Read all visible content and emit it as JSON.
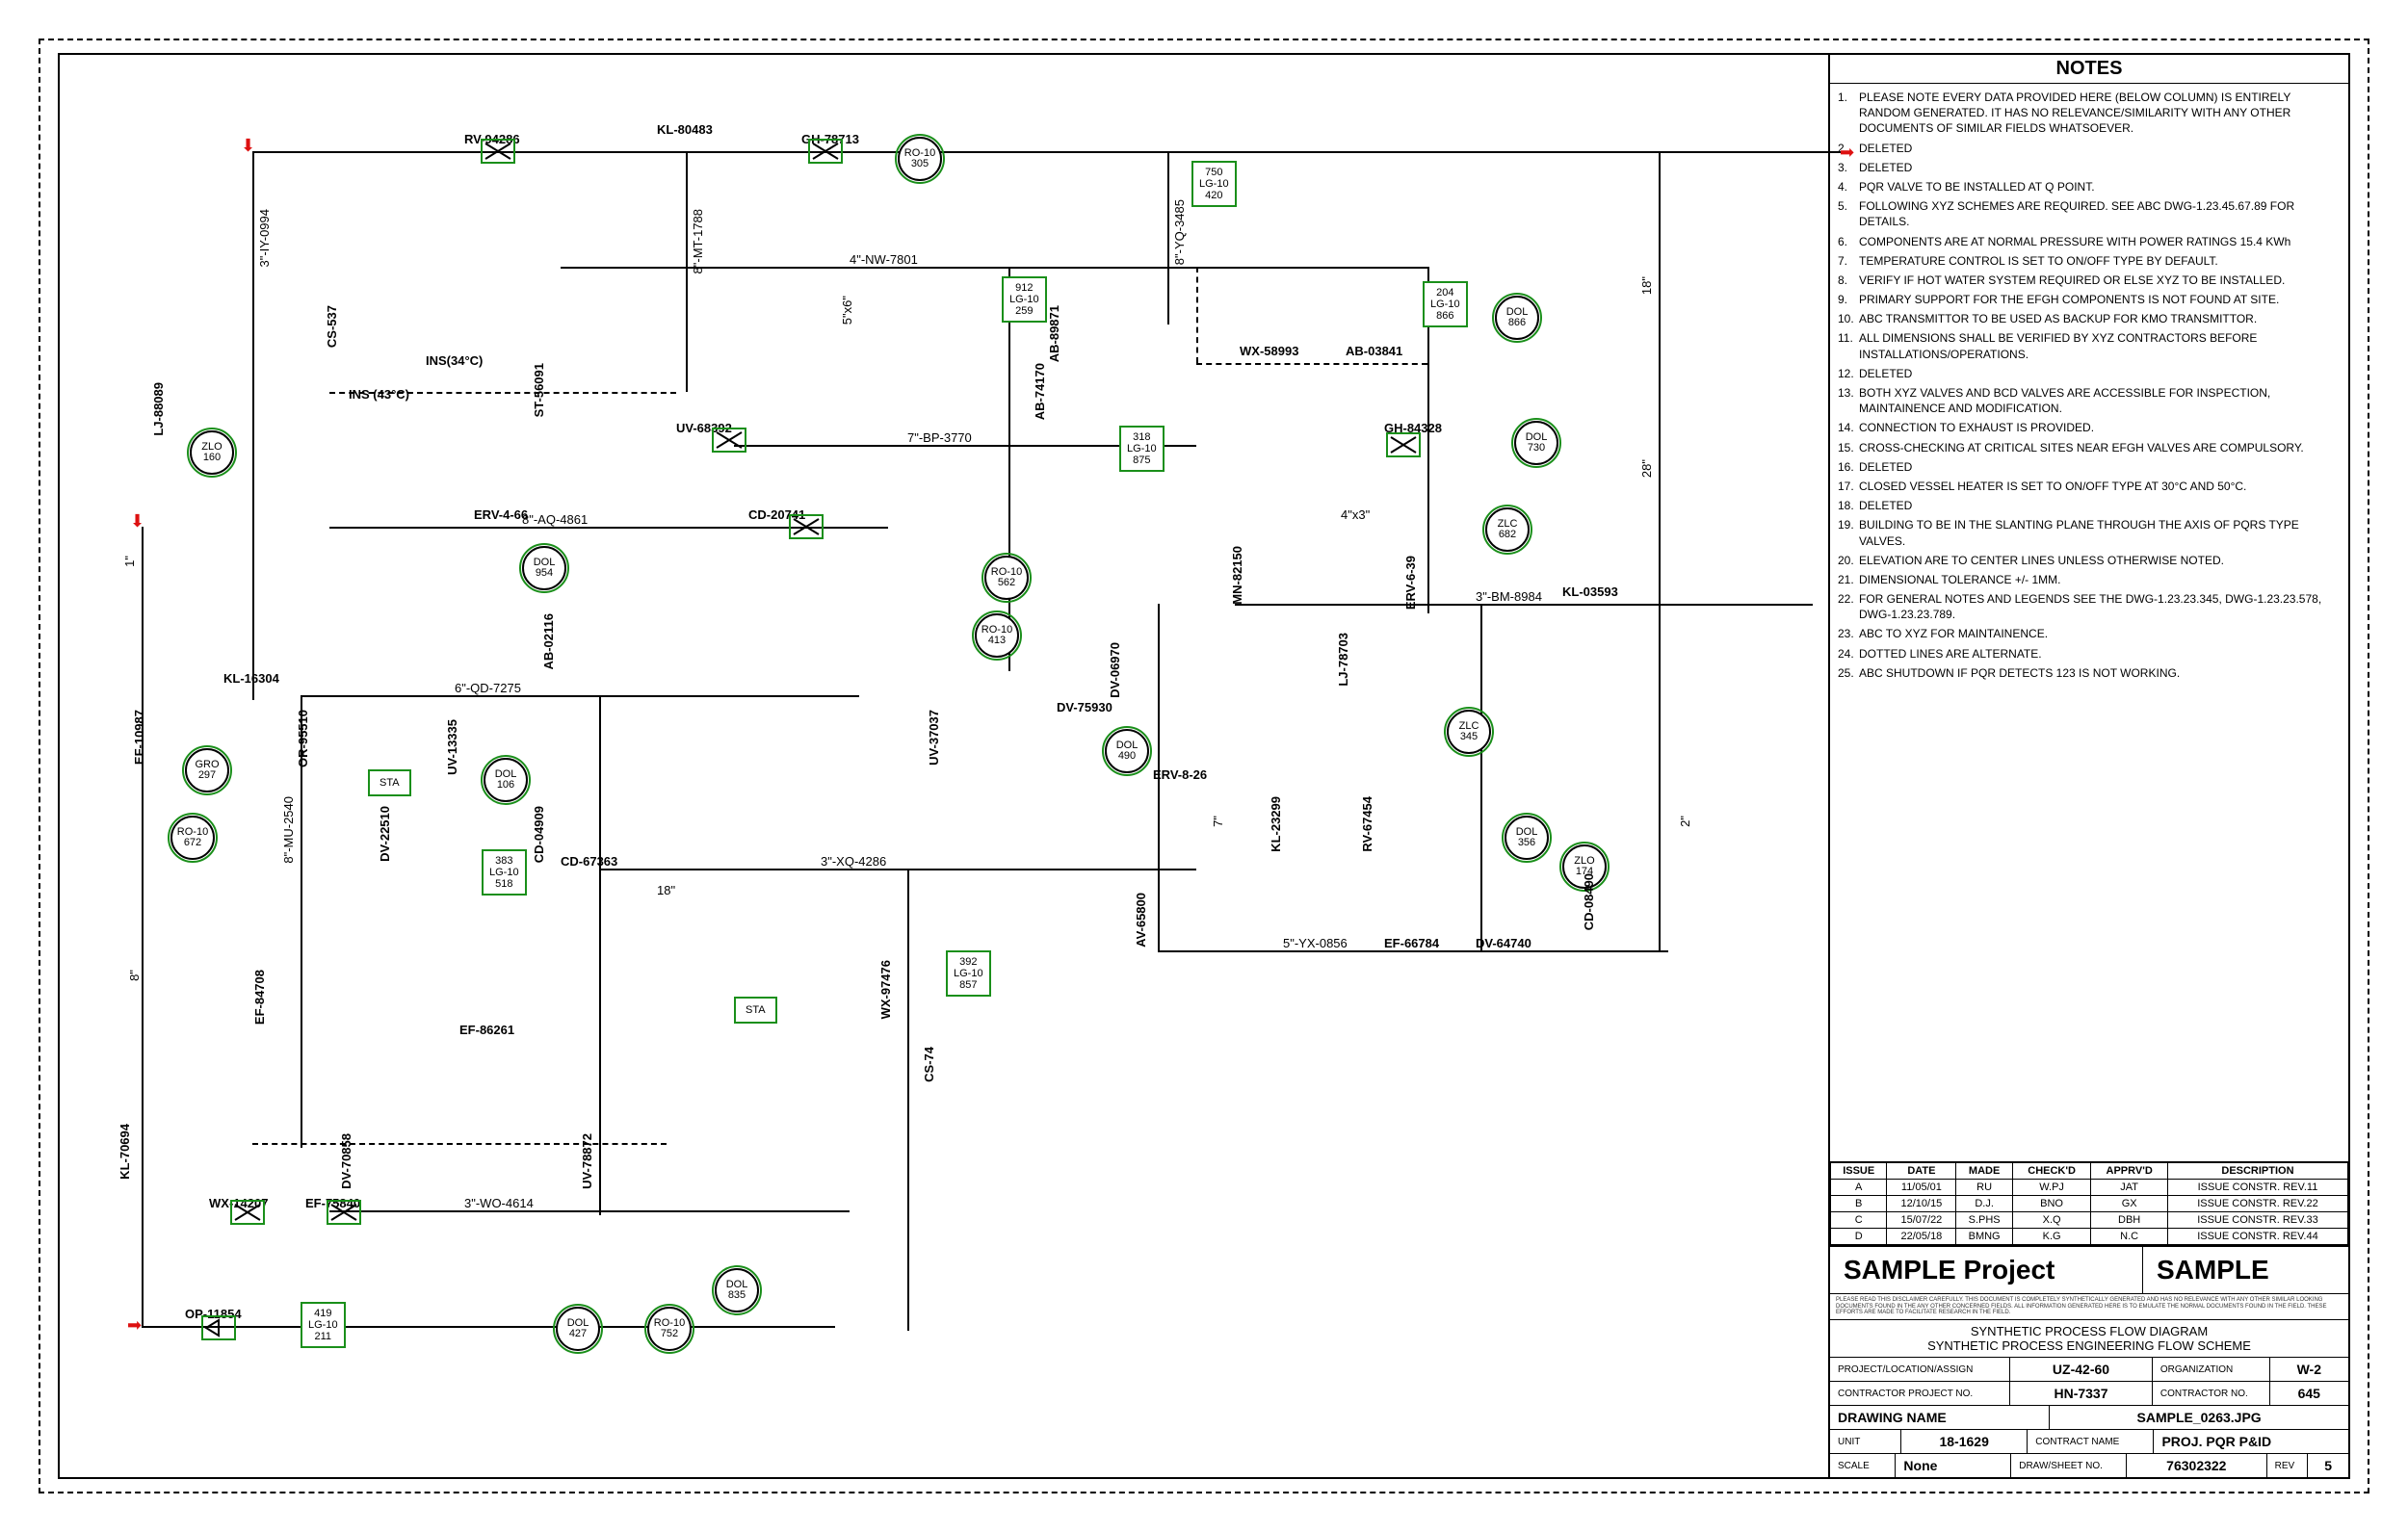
{
  "notes_header": "NOTES",
  "notes": [
    "PLEASE NOTE EVERY DATA PROVIDED HERE (BELOW COLUMN) IS ENTIRELY RANDOM GENERATED. IT HAS NO RELEVANCE/SIMILARITY WITH ANY OTHER DOCUMENTS OF SIMILAR FIELDS WHATSOEVER.",
    "DELETED",
    "DELETED",
    "PQR VALVE TO BE INSTALLED AT Q POINT.",
    "FOLLOWING XYZ SCHEMES ARE REQUIRED. SEE ABC DWG-1.23.45.67.89 FOR DETAILS.",
    "COMPONENTS ARE AT NORMAL PRESSURE WITH POWER RATINGS 15.4 KWh",
    "TEMPERATURE CONTROL IS SET TO ON/OFF TYPE BY DEFAULT.",
    "VERIFY IF HOT WATER SYSTEM REQUIRED OR ELSE XYZ TO BE INSTALLED.",
    "PRIMARY SUPPORT FOR THE EFGH COMPONENTS IS NOT FOUND AT SITE.",
    "ABC TRANSMITTOR TO BE USED AS BACKUP FOR KMO TRANSMITTOR.",
    "ALL DIMENSIONS SHALL BE VERIFIED BY XYZ CONTRACTORS BEFORE INSTALLATIONS/OPERATIONS.",
    "DELETED",
    "BOTH XYZ VALVES AND BCD VALVES ARE ACCESSIBLE FOR INSPECTION, MAINTAINENCE AND MODIFICATION.",
    "CONNECTION TO EXHAUST IS PROVIDED.",
    "CROSS-CHECKING AT CRITICAL SITES NEAR EFGH VALVES ARE COMPULSORY.",
    "DELETED",
    "CLOSED VESSEL HEATER IS SET TO ON/OFF TYPE AT 30°C AND 50°C.",
    "DELETED",
    "BUILDING TO BE IN THE SLANTING PLANE THROUGH THE AXIS OF PQRS TYPE VALVES.",
    "ELEVATION ARE TO CENTER LINES UNLESS OTHERWISE NOTED.",
    "DIMENSIONAL TOLERANCE +/- 1MM.",
    "FOR GENERAL NOTES AND LEGENDS SEE THE DWG-1.23.23.345, DWG-1.23.23.578, DWG-1.23.23.789.",
    "ABC TO XYZ FOR MAINTAINENCE.",
    "DOTTED LINES ARE ALTERNATE.",
    "ABC SHUTDOWN IF PQR DETECTS 123 IS NOT WORKING."
  ],
  "rev_headers": [
    "ISSUE",
    "DATE",
    "MADE",
    "CHECK'D",
    "APPRV'D",
    "DESCRIPTION"
  ],
  "revisions": [
    {
      "issue": "A",
      "date": "11/05/01",
      "made": "RU",
      "checkd": "W.PJ",
      "apprvd": "JAT",
      "desc": "ISSUE CONSTR. REV.11"
    },
    {
      "issue": "B",
      "date": "12/10/15",
      "made": "D.J.",
      "checkd": "BNO",
      "apprvd": "GX",
      "desc": "ISSUE CONSTR. REV.22"
    },
    {
      "issue": "C",
      "date": "15/07/22",
      "made": "S.PHS",
      "checkd": "X.Q",
      "apprvd": "DBH",
      "desc": "ISSUE CONSTR. REV.33"
    },
    {
      "issue": "D",
      "date": "22/05/18",
      "made": "BMNG",
      "checkd": "K.G",
      "apprvd": "N.C",
      "desc": "ISSUE CONSTR. REV.44"
    }
  ],
  "title_block": {
    "project": "SAMPLE Project",
    "sample": "SAMPLE",
    "subtitle1": "SYNTHETIC PROCESS FLOW DIAGRAM",
    "subtitle2": "SYNTHETIC PROCESS ENGINEERING FLOW SCHEME",
    "proj_loc_label": "PROJECT/LOCATION/ASSIGN",
    "proj_loc": "UZ-42-60",
    "org_label": "ORGANIZATION",
    "org": "W-2",
    "contractor_proj_label": "CONTRACTOR PROJECT NO.",
    "contractor_proj": "HN-7337",
    "contractor_no_label": "CONTRACTOR NO.",
    "contractor_no": "645",
    "drawing_name_label": "DRAWING NAME",
    "drawing_name": "SAMPLE_0263.JPG",
    "unit_label": "UNIT",
    "unit": "18-1629",
    "contract_name_label": "CONTRACT NAME",
    "contract_name": "PROJ. PQR P&ID",
    "scale_label": "SCALE",
    "scale": "None",
    "draw_sheet_label": "DRAW/SHEET NO.",
    "draw_sheet": "76302322",
    "rev_label": "REV",
    "rev": "5",
    "disclaimer": "PLEASE READ THIS DISCLAIMER CAREFULLY. THIS DOCUMENT IS COMPLETELY SYNTHETICALLY GENERATED AND HAS NO RELEVANCE WITH ANY OTHER SIMILAR LOOKING DOCUMENTS FOUND IN THE ANY OTHER CONCERNED FIELDS. ALL INFORMATION GENERATED HERE IS TO EMULATE THE NORMAL DOCUMENTS FOUND IN THE FIELD. THESE EFFORTS ARE MADE TO FACILITATE RESEARCH IN THE FIELD."
  },
  "pipes": {
    "IY0994": "3\"-IY-0994",
    "MT1788": "8\"-MT-1788",
    "NW7801": "4\"-NW-7801",
    "YQ3485": "8\"-YQ-3485",
    "BP3770": "7\"-BP-3770",
    "AQ4861": "8\"-AQ-4861",
    "BM8984": "3\"-BM-8984",
    "QD7275": "6\"-QD-7275",
    "MU2540": "8\"-MU-2540",
    "XQ4286": "3\"-XQ-4286",
    "YX0856": "5\"-YX-0856",
    "WO4614": "3\"-WO-4614"
  },
  "sizes": {
    "one": "1\"",
    "two": "2\"",
    "eighteen": "18\"",
    "eighteenv": "18\"",
    "twentyeight": "28\"",
    "seven": "7\"",
    "sixteen": "8\"",
    "fourx3": "4\"x3\"",
    "fivex6": "5\"x6\""
  },
  "instruments": {
    "ZLO160": {
      "t": "ZLO",
      "n": "160"
    },
    "GRO297": {
      "t": "GRO",
      "n": "297"
    },
    "RO672": {
      "t": "RO-10",
      "n": "672"
    },
    "RO305": {
      "t": "RO-10",
      "n": "305"
    },
    "DOL954": {
      "t": "DOL",
      "n": "954"
    },
    "DOL106": {
      "t": "DOL",
      "n": "106"
    },
    "RO562": {
      "t": "RO-10",
      "n": "562"
    },
    "RO413": {
      "t": "RO-10",
      "n": "413"
    },
    "DOL490": {
      "t": "DOL",
      "n": "490"
    },
    "DOL730": {
      "t": "DOL",
      "n": "730"
    },
    "ZLC682": {
      "t": "ZLC",
      "n": "682"
    },
    "ZLC345": {
      "t": "ZLC",
      "n": "345"
    },
    "DOL356": {
      "t": "DOL",
      "n": "356"
    },
    "ZLO174": {
      "t": "ZLO",
      "n": "174"
    },
    "DOL835": {
      "t": "DOL",
      "n": "835"
    },
    "DOL427": {
      "t": "DOL",
      "n": "427"
    },
    "RO752": {
      "t": "RO-10",
      "n": "752"
    },
    "DOL866": {
      "t": "DOL",
      "n": "866"
    }
  },
  "lg_boxes": {
    "b750": {
      "a": "750",
      "b": "LG-10",
      "c": "420"
    },
    "b912": {
      "a": "912",
      "b": "LG-10",
      "c": "259"
    },
    "b204": {
      "a": "204",
      "b": "LG-10",
      "c": "866"
    },
    "b318": {
      "a": "318",
      "b": "LG-10",
      "c": "875"
    },
    "b383": {
      "a": "383",
      "b": "LG-10",
      "c": "518"
    },
    "b392": {
      "a": "392",
      "b": "LG-10",
      "c": "857"
    },
    "b419": {
      "a": "419",
      "b": "LG-10",
      "c": "211"
    }
  },
  "equipment": {
    "RV94286": "RV-94286",
    "KL80483": "KL-80483",
    "GH78713": "GH-78713",
    "CS537": "CS-537",
    "INS34": "INS(34°C)",
    "ST56091": "ST-56091",
    "INS43": "INS (43°C)",
    "LJ88089": "LJ-88089",
    "UV68392": "UV-68392",
    "AB74170": "AB-74170",
    "AB89871": "AB-89871",
    "WX58993": "WX-58993",
    "AB03841": "AB-03841",
    "GH84328": "GH-84328",
    "ERV466": "ERV-4-66",
    "CD20741": "CD-20741",
    "MN82150": "MN-82150",
    "ERV639": "ERV-6-39",
    "KL03593": "KL-03593",
    "KL16304": "KL-16304",
    "EF10987": "EF-10987",
    "OR95510": "OR-95510",
    "UV13335": "UV-13335",
    "AB02116": "AB-02116",
    "DV75930": "DV-75930",
    "DV06970": "DV-06970",
    "LJ78703": "LJ-78703",
    "ERV826": "ERV-8-26",
    "DV22510": "DV-22510",
    "CD04909": "CD-04909",
    "CD67363": "CD-67363",
    "KL23299": "KL-23299",
    "RV67454": "RV-67454",
    "EF66784": "EF-66784",
    "DV64740": "DV-64740",
    "CD08490": "CD-08490",
    "AV65800": "AV-65800",
    "EF84708": "EF-84708",
    "EF86261": "EF-86261",
    "WX97476": "WX-97476",
    "UV37037": "UV-37037",
    "UV78872": "UV-78872",
    "KL70694": "KL-70694",
    "WX14207": "WX-14207",
    "EF75840": "EF-75840",
    "OP11854": "OP-11854",
    "CS74": "CS-74",
    "STA1": "STA",
    "STA2": "STA",
    "DV70858": "DV-70858"
  }
}
